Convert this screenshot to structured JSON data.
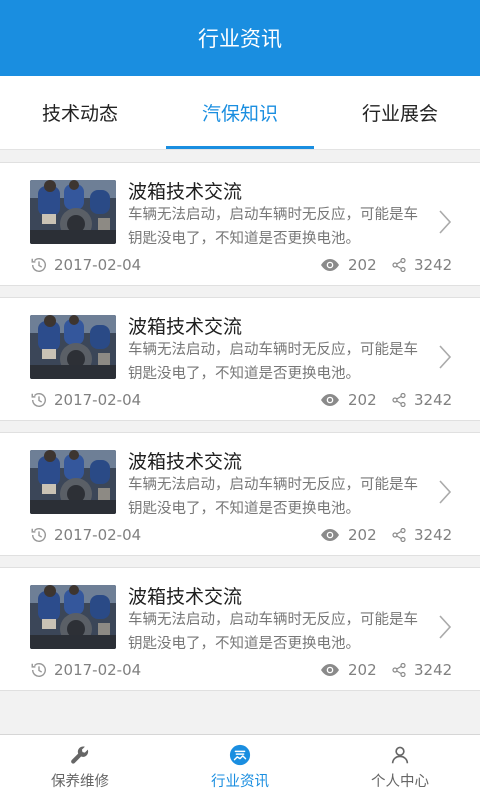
{
  "header": {
    "title": "行业资讯"
  },
  "tabs": [
    {
      "label": "技术动态",
      "active": false
    },
    {
      "label": "汽保知识",
      "active": true
    },
    {
      "label": "行业展会",
      "active": false
    }
  ],
  "articles": [
    {
      "title": "波箱技术交流",
      "desc": "车辆无法启动，启动车辆时无反应，可能是车钥匙没电了，不知道是否更换电池。",
      "date": "2017-02-04",
      "views": "202",
      "shares": "3242"
    },
    {
      "title": "波箱技术交流",
      "desc": "车辆无法启动，启动车辆时无反应，可能是车钥匙没电了，不知道是否更换电池。",
      "date": "2017-02-04",
      "views": "202",
      "shares": "3242"
    },
    {
      "title": "波箱技术交流",
      "desc": "车辆无法启动，启动车辆时无反应，可能是车钥匙没电了，不知道是否更换电池。",
      "date": "2017-02-04",
      "views": "202",
      "shares": "3242"
    },
    {
      "title": "波箱技术交流",
      "desc": "车辆无法启动，启动车辆时无反应，可能是车钥匙没电了，不知道是否更换电池。",
      "date": "2017-02-04",
      "views": "202",
      "shares": "3242"
    }
  ],
  "bottom_nav": [
    {
      "label": "保养维修",
      "icon": "wrench-icon",
      "active": false
    },
    {
      "label": "行业资讯",
      "icon": "news-icon",
      "active": true
    },
    {
      "label": "个人中心",
      "icon": "person-icon",
      "active": false
    }
  ],
  "colors": {
    "accent": "#1a8ee0",
    "background": "#f2f2f2"
  }
}
